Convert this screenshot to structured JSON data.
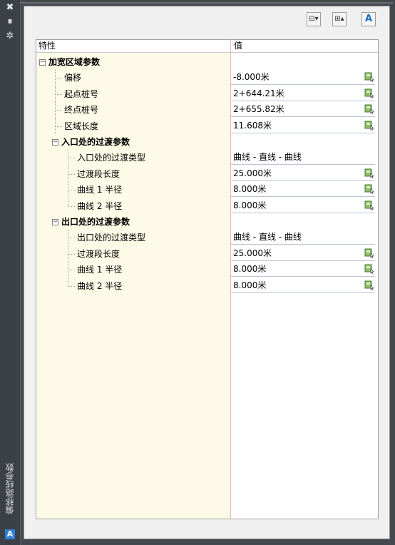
{
  "palette": {
    "title_strip": "#3c4148",
    "grid_background": "#fdfbe8",
    "accent": "#2f7fd1"
  },
  "window": {
    "title": "偏移路线参数",
    "strip_buttons": [
      "close-icon",
      "auto-hide-icon",
      "properties-icon"
    ],
    "strip_glyphs": {
      "close": "✖",
      "autohide": "⏸",
      "props": "✲"
    },
    "logo": "A"
  },
  "toolbar": {
    "buttons": [
      {
        "name": "collapse-all-icon",
        "glyph": "⊟▾"
      },
      {
        "name": "expand-all-icon",
        "glyph": "⊞▴"
      },
      {
        "name": "autocad-icon",
        "glyph": "A"
      }
    ]
  },
  "grid": {
    "header_property": "特性",
    "header_value": "值",
    "sections": [
      {
        "label": "加宽区域参数",
        "rows": [
          {
            "label": "偏移",
            "value": "-8.000米",
            "pick": true
          },
          {
            "label": "起点桩号",
            "value": "2+644.21米",
            "pick": true
          },
          {
            "label": "终点桩号",
            "value": "2+655.82米",
            "pick": true
          },
          {
            "label": "区域长度",
            "value": "11.608米",
            "pick": true
          }
        ],
        "subsections": [
          {
            "label": "入口处的过渡参数",
            "rows": [
              {
                "label": "入口处的过渡类型",
                "value": "曲线 - 直线 - 曲线",
                "pick": false
              },
              {
                "label": "过渡段长度",
                "value": "25.000米",
                "pick": true
              },
              {
                "label": "曲线 1 半径",
                "value": "8.000米",
                "pick": true
              },
              {
                "label": "曲线 2 半径",
                "value": "8.000米",
                "pick": true
              }
            ]
          },
          {
            "label": "出口处的过渡参数",
            "rows": [
              {
                "label": "出口处的过渡类型",
                "value": "曲线 - 直线 - 曲线",
                "pick": false
              },
              {
                "label": "过渡段长度",
                "value": "25.000米",
                "pick": true
              },
              {
                "label": "曲线 1 半径",
                "value": "8.000米",
                "pick": true
              },
              {
                "label": "曲线 2 半径",
                "value": "8.000米",
                "pick": true
              }
            ]
          }
        ]
      }
    ]
  }
}
